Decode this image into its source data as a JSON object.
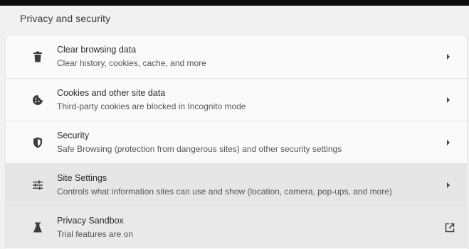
{
  "section": {
    "title": "Privacy and security"
  },
  "rows": [
    {
      "label": "Clear browsing data",
      "sub": "Clear history, cookies, cache, and more",
      "icon": "trash-icon",
      "action": "chevron-right-icon"
    },
    {
      "label": "Cookies and other site data",
      "sub": "Third-party cookies are blocked in Incognito mode",
      "icon": "cookie-icon",
      "action": "chevron-right-icon"
    },
    {
      "label": "Security",
      "sub": "Safe Browsing (protection from dangerous sites) and other security settings",
      "icon": "shield-icon",
      "action": "chevron-right-icon"
    },
    {
      "label": "Site Settings",
      "sub": "Controls what information sites can use and show (location, camera, pop-ups, and more)",
      "icon": "sliders-icon",
      "action": "chevron-right-icon"
    },
    {
      "label": "Privacy Sandbox",
      "sub": "Trial features are on",
      "icon": "flask-icon",
      "action": "external-link-icon"
    }
  ]
}
